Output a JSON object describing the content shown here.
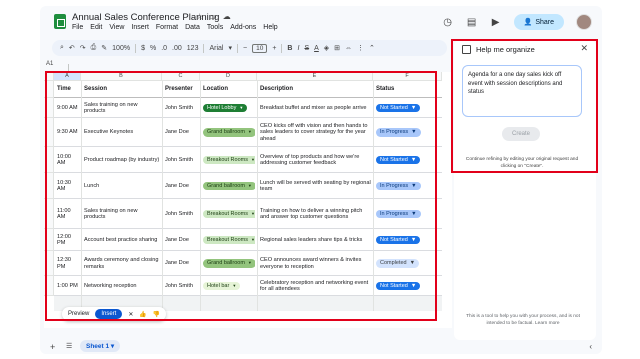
{
  "app": {
    "doc_title": "Annual Sales Conference Planning",
    "title_icons": [
      "star-icon",
      "folder-icon",
      "cloud-icon"
    ],
    "menu": [
      "File",
      "Edit",
      "View",
      "Insert",
      "Format",
      "Data",
      "Tools",
      "Add-ons",
      "Help"
    ],
    "share_label": "Share"
  },
  "toolbar": {
    "zoom": "100%",
    "currency": "$",
    "percent": "%",
    "decimals_less": ".0",
    "decimals_more": ".00",
    "number_format": "123",
    "font": "Arial",
    "font_size": "10",
    "bold": "B",
    "italic": "I"
  },
  "namebox": "A1",
  "columns": [
    "A",
    "B",
    "C",
    "D",
    "E",
    "F"
  ],
  "table": {
    "headers": [
      "Time",
      "Session",
      "Presenter",
      "Location",
      "Description",
      "Status"
    ],
    "rows": [
      {
        "time": "9:00 AM",
        "session": "Sales training on new products",
        "presenter": "John Smith",
        "location": "Hotel Lobby",
        "description": "Breakfast buffet and mixer as people arrive",
        "status": "Not Started"
      },
      {
        "time": "9:30 AM",
        "session": "Executive Keynotes",
        "presenter": "Jane Doe",
        "location": "Grand ballroom",
        "description": "CEO kicks off with vision and then hands to sales leaders to cover strategy for the year ahead",
        "status": "In Progress"
      },
      {
        "time": "10:00 AM",
        "session": "Product roadmap (by industry)",
        "presenter": "John Smith",
        "location": "Breakout Rooms",
        "description": "Overview of top products and how we're addressing customer feedback",
        "status": "Not Started"
      },
      {
        "time": "10:30 AM",
        "session": "Lunch",
        "presenter": "Jane Doe",
        "location": "Grand ballroom",
        "description": "Lunch will be served with seating by regional team",
        "status": "In Progress"
      },
      {
        "time": "11:00 AM",
        "session": "Sales training on new products",
        "presenter": "John Smith",
        "location": "Breakout Rooms",
        "description": "Training on how to deliver a winning pitch and answer top customer questions",
        "status": "In Progress"
      },
      {
        "time": "12:00 PM",
        "session": "Account best practice sharing",
        "presenter": "Jane Doe",
        "location": "Breakout Rooms",
        "description": "Regional sales leaders share tips & tricks",
        "status": "Not Started"
      },
      {
        "time": "12:30 PM",
        "session": "Awards ceremony and closing remarks",
        "presenter": "Jane Doe",
        "location": "Grand ballroom",
        "description": "CEO announces award winners & invites everyone to reception",
        "status": "Completed"
      },
      {
        "time": "1:00 PM",
        "session": "Networking reception",
        "presenter": "John Smith",
        "location": "Hotel bar",
        "description": "Celebratory reception and networking event for all attendees",
        "status": "Not Started"
      }
    ]
  },
  "location_colors": {
    "Hotel Lobby": {
      "bg": "#1e7e34",
      "fg": "#ffffff"
    },
    "Grand ballroom": {
      "bg": "#93c47d",
      "fg": "#1b3d12"
    },
    "Breakout Rooms": {
      "bg": "#cde8c2",
      "fg": "#1b3d12"
    },
    "Hotel bar": {
      "bg": "#e6f4d7",
      "fg": "#1b3d12"
    }
  },
  "status_colors": {
    "Not Started": {
      "bg": "#1a73e8",
      "fg": "#ffffff"
    },
    "In Progress": {
      "bg": "#a8c7fa",
      "fg": "#0b3a7a"
    },
    "Completed": {
      "bg": "#d3e3fd",
      "fg": "#3c4043"
    }
  },
  "floatbar": {
    "preview_label": "Preview",
    "insert_label": "Insert"
  },
  "panel": {
    "title": "Help me organize",
    "prompt": "Agenda for a one day sales kick off event with session descriptions and status",
    "create_label": "Create",
    "hint": "Continue refining by editing your original request and clicking on \"Create\".",
    "footer": "This is a tool to help you with your process, and is not intended to be factual. Learn more"
  },
  "sheets": {
    "active_tab": "Sheet 1"
  },
  "annotation_color": "#e2001a"
}
